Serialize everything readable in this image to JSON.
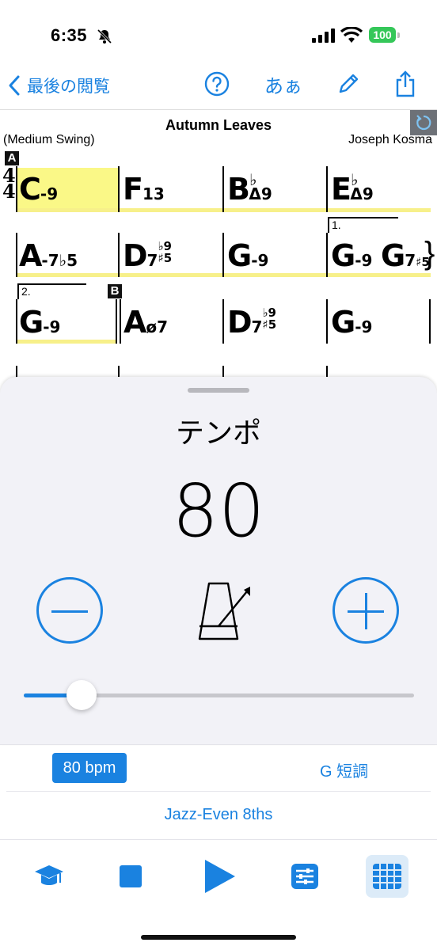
{
  "status": {
    "time": "6:35",
    "battery": "100"
  },
  "nav": {
    "back_label": "最後の閲覧",
    "kana_label": "あぁ"
  },
  "song": {
    "title": "Autumn Leaves",
    "style": "(Medium Swing)",
    "composer": "Joseph Kosma",
    "time_signature": [
      "4",
      "4"
    ],
    "sections": [
      "A",
      "B"
    ],
    "endings": [
      "1.",
      "2."
    ],
    "rows": [
      [
        "C-9",
        "F13",
        "B♭Δ9",
        "E♭Δ9"
      ],
      [
        "A-7♭5",
        "D7♭9♯5",
        "G-9",
        "G-9 G7♯5"
      ],
      [
        "G-9",
        "Aø7",
        "D7♭9♯5",
        "G-9"
      ]
    ],
    "chords": {
      "c_root": "C",
      "c_ext": "-9",
      "f_root": "F",
      "f_ext": "13",
      "bb_root": "B",
      "bb_acc": "♭",
      "bb_ext": "Δ9",
      "eb_root": "E",
      "eb_acc": "♭",
      "eb_ext": "Δ9",
      "a_root": "A",
      "a_ext": "-7♭5",
      "d_root": "D",
      "d_num": "7",
      "d_top": "♭9",
      "d_bot": "♯5",
      "g1_root": "G",
      "g1_ext": "-9",
      "g2_root": "G",
      "g2_ext": "-9",
      "g3_root": "G",
      "g3_num": "7",
      "g3_ext": "♯5",
      "g4_root": "G",
      "g4_ext": "-9",
      "a2_root": "A",
      "a2_ext": "ø7",
      "d2_root": "D",
      "d2_num": "7",
      "d2_top": "♭9",
      "d2_bot": "♯5",
      "g5_root": "G",
      "g5_ext": "-9"
    }
  },
  "tempo_panel": {
    "title": "テンポ",
    "value": "80",
    "slider_fraction": 0.15
  },
  "info": {
    "bpm_label": "80 bpm",
    "key_label": "G 短調",
    "style_label": "Jazz-Even 8ths"
  },
  "colors": {
    "accent": "#1a82e0",
    "highlight": "#faf887",
    "battery": "#35c759"
  },
  "tabbar": {
    "icons": [
      "graduation-cap-icon",
      "stop-icon",
      "play-icon",
      "mixer-icon",
      "grid-icon"
    ]
  }
}
